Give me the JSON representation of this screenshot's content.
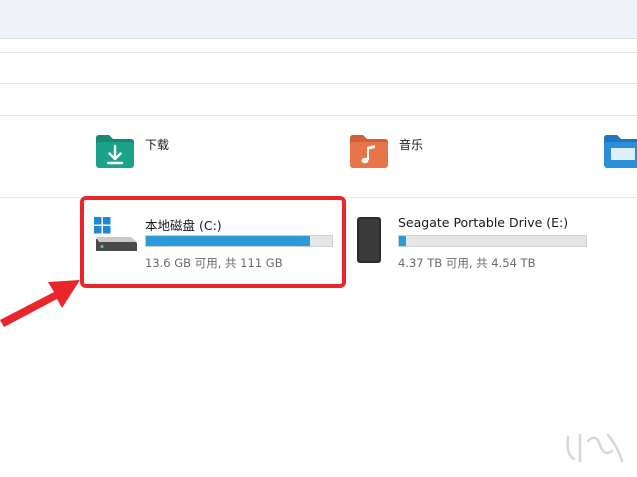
{
  "folders": [
    {
      "label": "下载",
      "icon": "download-folder-icon"
    },
    {
      "label": "音乐",
      "icon": "music-folder-icon"
    },
    {
      "label": "",
      "icon": "desktop-folder-icon"
    }
  ],
  "drives": [
    {
      "name": "本地磁盘 (C:)",
      "space": "13.6 GB 可用, 共 111 GB",
      "used_fraction": 0.88,
      "icon": "windows-drive-icon"
    },
    {
      "name": "Seagate Portable Drive (E:)",
      "space": "4.37 TB 可用, 共 4.54 TB",
      "used_fraction": 0.04,
      "icon": "external-drive-icon"
    }
  ],
  "colors": {
    "accent_bar": "#2b9bd8",
    "highlight": "#e8262b",
    "download_folder": "#1aa38a",
    "music_folder": "#e8744a",
    "desktop_folder": "#2a8fd6"
  }
}
